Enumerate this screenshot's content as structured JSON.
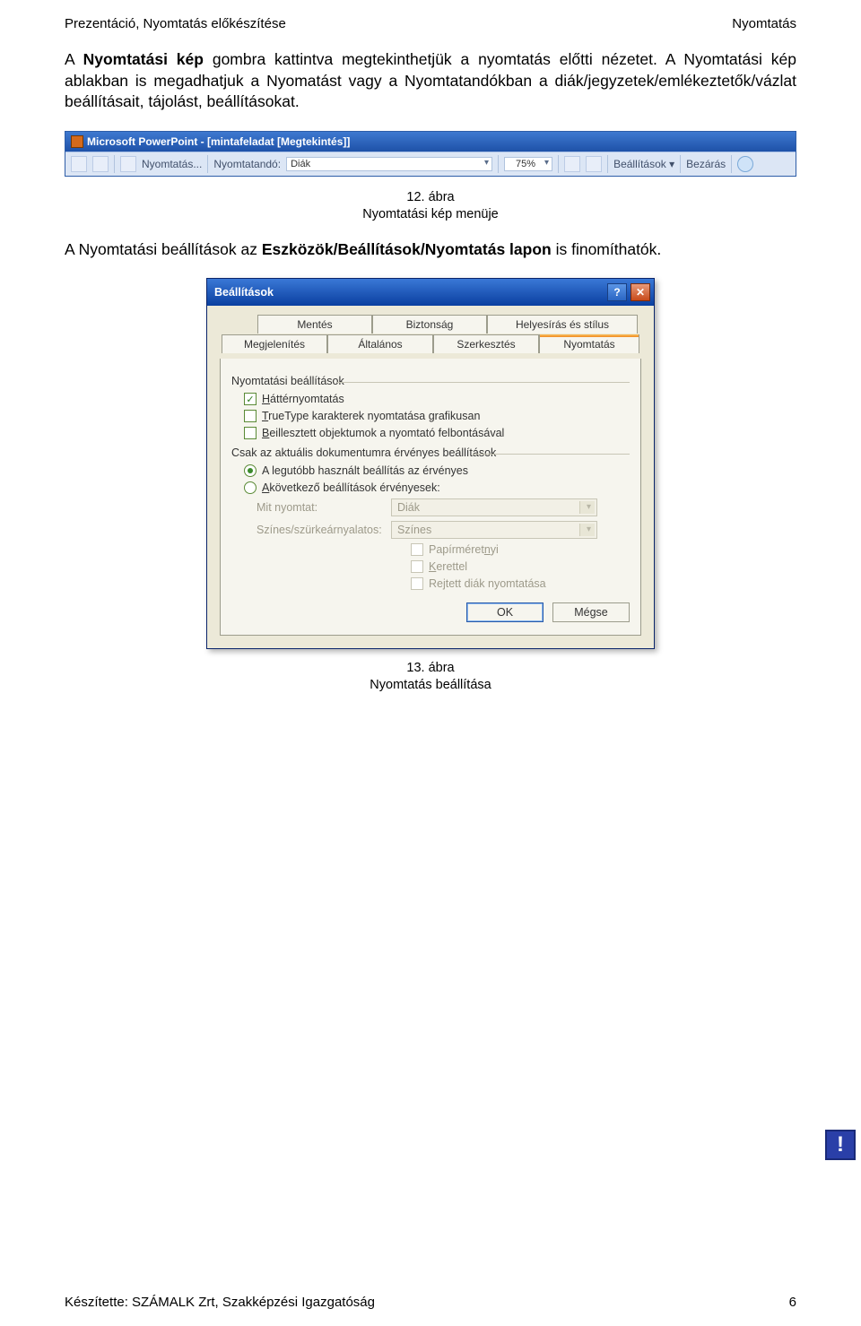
{
  "header": {
    "left": "Prezentáció, Nyomtatás előkészítése",
    "right": "Nyomtatás"
  },
  "para1": {
    "pre": "A ",
    "bold": "Nyomtatási kép",
    "post": " gombra kattintva megtekinthetjük a nyomtatás előtti nézetet. A Nyomtatási kép ablakban is megadhatjuk a Nyomatást vagy a Nyomtatandókban a diák/jegyzetek/emlékeztetők/vázlat beállításait, tájolást, beállításokat."
  },
  "fig12": {
    "title": "Microsoft PowerPoint - [mintafeladat [Megtekintés]]",
    "print": "Nyomtatás...",
    "printable_label": "Nyomtatandó:",
    "printable_value": "Diák",
    "zoom": "75%",
    "settings": "Beállítások",
    "close": "Bezárás",
    "caption_line1": "12. ábra",
    "caption_line2": "Nyomtatási kép menüje"
  },
  "para2": {
    "pre": "A Nyomtatási beállítások az ",
    "bold": "Eszközök/Beállítások/Nyomtatás lapon",
    "post": " is finomíthatók."
  },
  "dialog": {
    "title": "Beállítások",
    "tabs_back": [
      "Mentés",
      "Biztonság",
      "Helyesírás és stílus"
    ],
    "tabs_front": [
      "Megjelenítés",
      "Általános",
      "Szerkesztés",
      "Nyomtatás"
    ],
    "group1": "Nyomtatási beállítások",
    "cb1": {
      "u": "H",
      "rest": "áttérnyomtatás",
      "checked": true
    },
    "cb2": {
      "u": "T",
      "rest": "rueType karakterek nyomtatása grafikusan",
      "checked": false
    },
    "cb3": {
      "u": "B",
      "rest": "eillesztett objektumok a nyomtató felbontásával",
      "checked": false
    },
    "group2": "Csak az aktuális dokumentumra érvényes beállítások",
    "radio1": "A legutóbb használt beállítás az érvényes",
    "radio2_pre": "A",
    "radio2_u": " ",
    "radio2_rest": "következő beállítások érvényesek:",
    "mit_u": "M",
    "mit_rest": "it nyomtat:",
    "mit_value": "Diák",
    "szines_pre": "Sz",
    "szines_u": "í",
    "szines_rest": "nes/szürkeárnyalatos:",
    "szines_value": "Színes",
    "cb4_pre": "Papírméret",
    "cb4_u": "n",
    "cb4_rest": "yi",
    "cb5_u": "K",
    "cb5_rest": "erettel",
    "cb6": "Rejtett diák nyomtatása",
    "ok": "OK",
    "cancel": "Mégse"
  },
  "fig13": {
    "line1": "13. ábra",
    "line2": "Nyomtatás beállítása"
  },
  "footer": {
    "left": "Készítette: SZÁMALK Zrt, Szakképzési Igazgatóság",
    "right": "6"
  }
}
